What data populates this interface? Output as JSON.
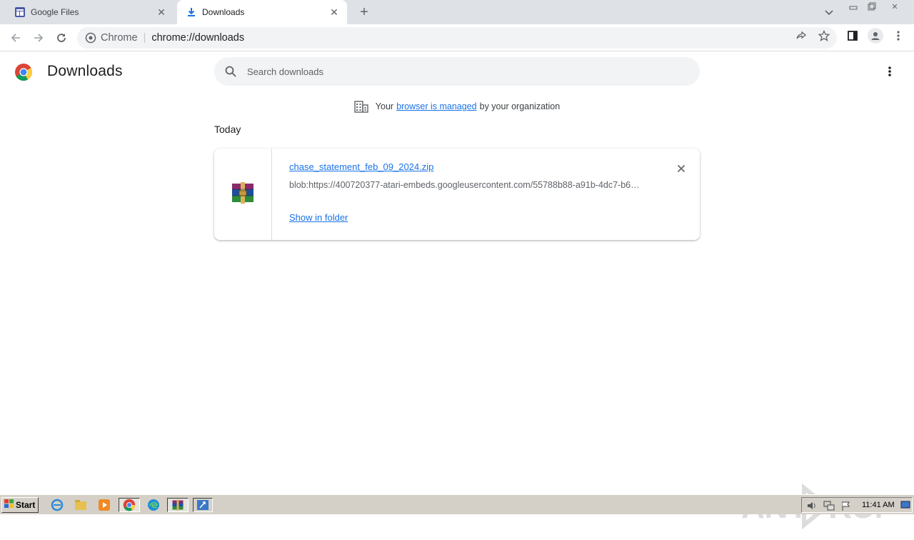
{
  "browser": {
    "tabs": [
      {
        "label": "Google Files",
        "icon": "google-files-icon",
        "active": false
      },
      {
        "label": "Downloads",
        "icon": "download-icon",
        "active": true
      }
    ],
    "omnibox": {
      "chip": "Chrome",
      "url": "chrome://downloads"
    }
  },
  "page": {
    "title": "Downloads",
    "search_placeholder": "Search downloads",
    "managed": {
      "prefix": "Your",
      "link": "browser is managed",
      "suffix": "by your organization"
    },
    "date_header": "Today",
    "items": [
      {
        "filename": "chase_statement_feb_09_2024.zip",
        "source": "blob:https://400720377-atari-embeds.googleusercontent.com/55788b88-a91b-4dc7-b6…",
        "action": "Show in folder",
        "icon": "winrar-archive-icon"
      }
    ]
  },
  "watermark": "ANY RUN",
  "taskbar": {
    "start_label": "Start",
    "clock": "11:41 AM"
  },
  "colors": {
    "link": "#1a73e8",
    "tabstrip": "#dee1e6",
    "taskbar": "#d4d0c8"
  }
}
